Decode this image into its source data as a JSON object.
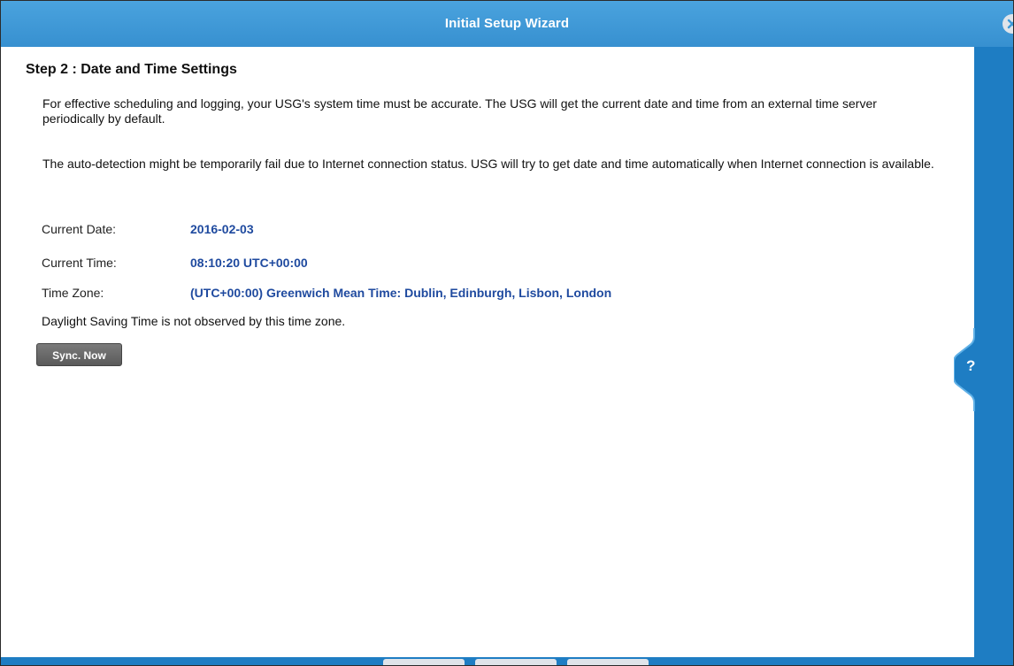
{
  "dialog": {
    "title": "Initial Setup Wizard",
    "close_icon": "close-circle-icon",
    "help_label": "?"
  },
  "step": {
    "title": "Step 2 : Date and Time Settings",
    "paragraph1": "For effective scheduling and logging, your USG's system time must be accurate. The USG will get the current date and time from an external time server periodically by default.",
    "paragraph2": "The auto-detection might be temporarily fail due to Internet connection status. USG will try to get date and time automatically when Internet connection is available."
  },
  "settings": {
    "current_date_label": "Current Date:",
    "current_date_value": "2016-02-03",
    "current_time_label": "Current Time:",
    "current_time_value": "08:10:20 UTC+00:00",
    "time_zone_label": "Time Zone:",
    "time_zone_value": "(UTC+00:00) Greenwich Mean Time: Dublin, Edinburgh, Lisbon, London",
    "dst_note": "Daylight Saving Time is not observed by this time zone."
  },
  "actions": {
    "sync_label": "Sync. Now"
  },
  "colors": {
    "title_bar": "#3d9ad8",
    "side_panel": "#1e7dc3",
    "value_text": "#1f4a9f",
    "button_bg": "#666666"
  }
}
